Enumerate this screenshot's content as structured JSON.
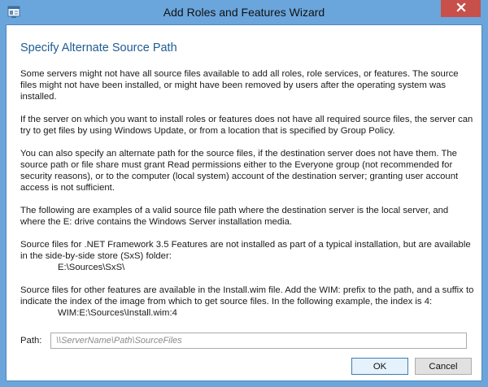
{
  "window": {
    "title": "Add Roles and Features Wizard"
  },
  "dialog": {
    "heading": "Specify Alternate Source Path",
    "paragraphs": [
      "Some servers might not have all source files available to add all roles, role services, or features. The source files might not have been installed, or might have been removed by users after the operating system was installed.",
      "If the server on which you want to install roles or features does not have all required source files, the server can try to get files by using Windows Update, or from a location that is specified by Group Policy.",
      "You can also specify an alternate path for the source files, if the destination server does not have them. The source path or file share must grant Read permissions either to the Everyone group (not recommended for security reasons), or to the computer (local system) account of the destination server; granting user account access is not sufficient.",
      "The following are examples of a valid source file path where the destination server is the local server, and where the E: drive contains the Windows Server installation media."
    ],
    "example1_text": "Source files for .NET Framework 3.5 Features are not installed as part of a typical installation, but are available in the side-by-side store (SxS) folder:",
    "example1_path": "E:\\Sources\\SxS\\",
    "example2_text": "Source files for other features are available in the Install.wim file. Add the WIM: prefix to the path, and a suffix to indicate the index of the image from which to get source files. In the following example, the index is 4:",
    "example2_path": "WIM:E:\\Sources\\Install.wim:4",
    "path_label": "Path:",
    "path_placeholder": "\\\\ServerName\\Path\\SourceFiles",
    "path_value": "",
    "ok_label": "OK",
    "cancel_label": "Cancel"
  },
  "icons": {
    "app": "server-manager-icon",
    "close": "close-icon"
  },
  "colors": {
    "titlebar": "#6aa6dc",
    "close_button": "#c7504b",
    "heading": "#1e5c93"
  }
}
